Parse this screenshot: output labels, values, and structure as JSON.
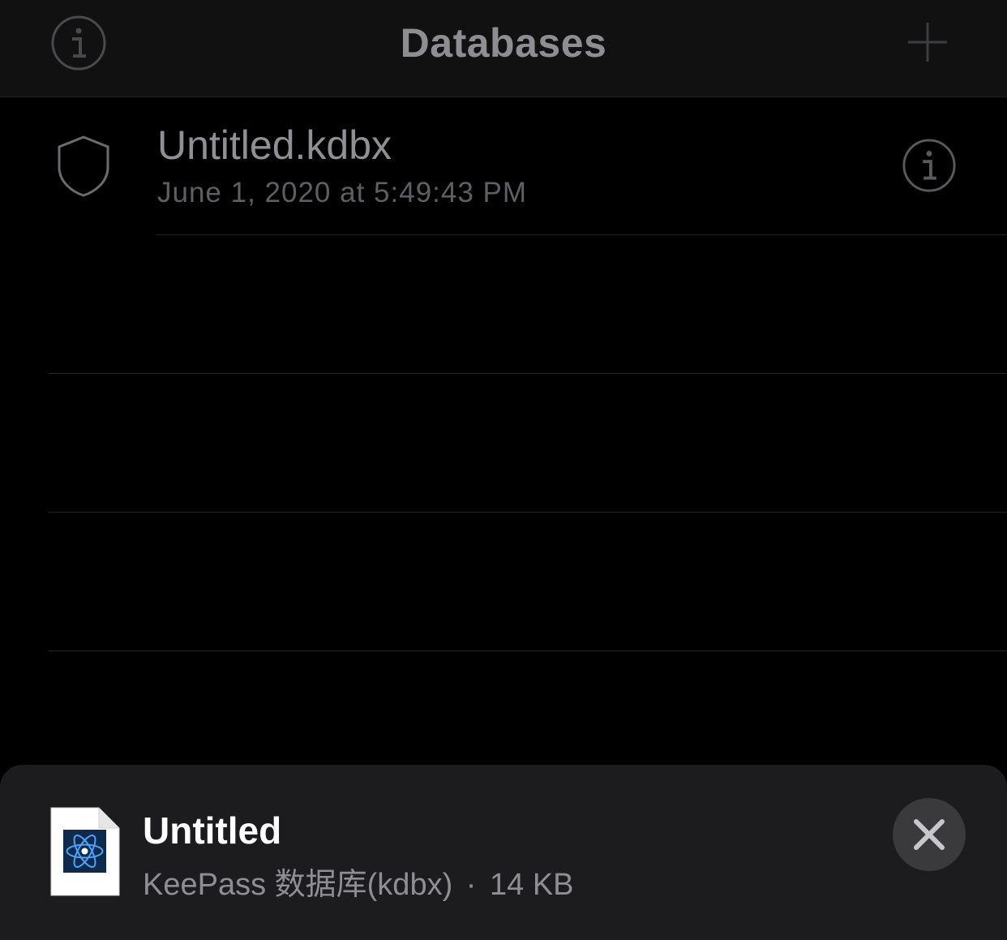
{
  "navbar": {
    "title": "Databases",
    "left_icon": "info-icon",
    "right_icon": "plus-icon"
  },
  "databases": [
    {
      "name": "Untitled.kdbx",
      "modified": "June 1, 2020 at 5:49:43 PM",
      "icon": "shield-icon",
      "accessory_icon": "info-icon"
    }
  ],
  "share_sheet": {
    "file_title": "Untitled",
    "file_type": "KeePass 数据库(kdbx)",
    "separator": "·",
    "file_size": "14 KB",
    "file_icon": "keepass-document-icon",
    "close_icon": "close-icon"
  },
  "colors": {
    "background": "#000000",
    "navbar": "#111111",
    "sheet": "#1c1c1e",
    "icon_gray": "#5a5a5e",
    "close_button": "#3a3a3c"
  }
}
